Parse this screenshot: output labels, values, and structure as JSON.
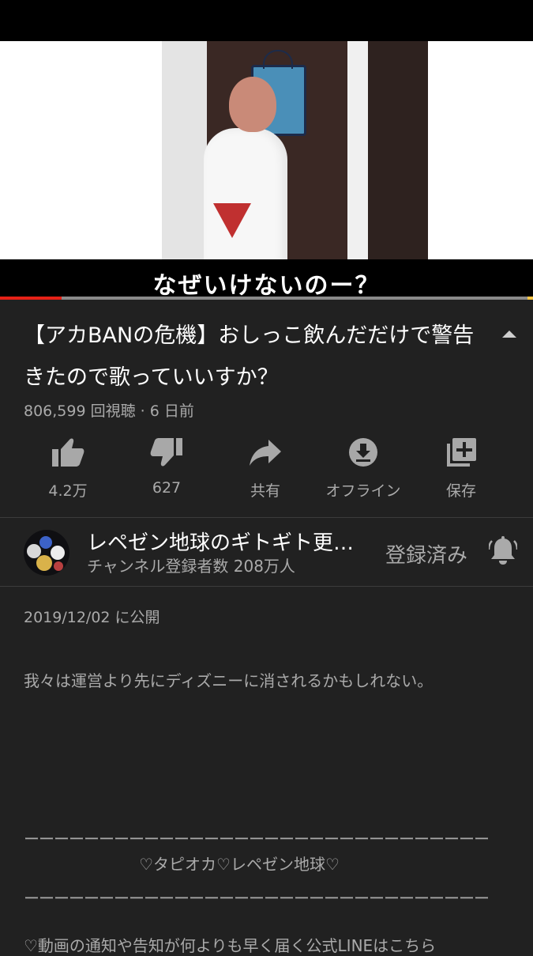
{
  "video": {
    "caption": "なぜいけないのー？",
    "progress": 0.115
  },
  "title": "【アカBANの危機】おしっこ飲んだだけで警告きたので歌っていいすか？",
  "meta": {
    "views": "806,599 回視聴 · 6 日前"
  },
  "actions": {
    "like_label": "4.2万",
    "dislike_label": "627",
    "share_label": "共有",
    "offline_label": "オフライン",
    "save_label": "保存"
  },
  "channel": {
    "name": "レペゼン地球のギトギト更…",
    "subscribers": "チャンネル登録者数 208万人",
    "subscribed_label": "登録済み"
  },
  "description": {
    "published": "2019/12/02 に公開",
    "line1": "我々は運営より先にディズニーに消されるかもしれない。",
    "rule1": "ーーーーーーーーーーーーーーーーーーーーーーーーーーーーーーー",
    "heading": "♡タピオカ♡レペゼン地球♡",
    "rule2": "ーーーーーーーーーーーーーーーーーーーーーーーーーーーーーーー",
    "line2": "♡動画の通知や告知が何よりも早く届く公式LINEはこちら"
  },
  "colors": {
    "background": "#212121",
    "progress_played": "#e62117",
    "secondary_text": "#aaaaaa"
  }
}
